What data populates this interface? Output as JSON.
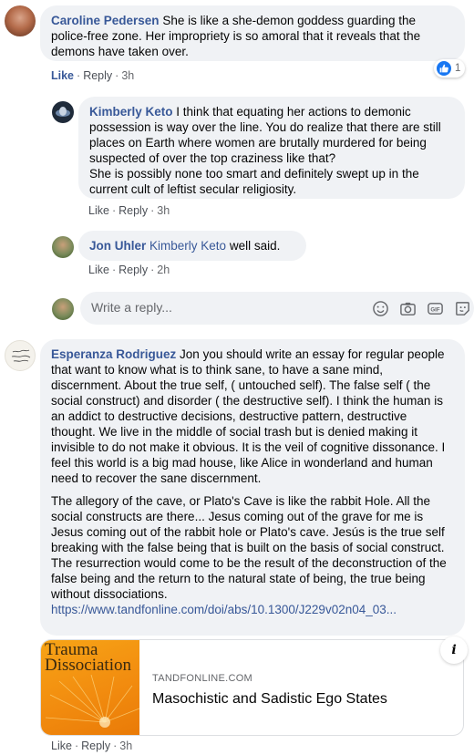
{
  "comments": [
    {
      "author": "Caroline Pedersen",
      "text": "She is like a she-demon goddess guarding the police-free zone. Her impropriety is so amoral that it reveals that the demons have taken over.",
      "like_label": "Like",
      "reply_label": "Reply",
      "time": "3h",
      "reaction_count": "1",
      "replies": [
        {
          "author": "Kimberly Keto",
          "text": "I think that equating her actions to demonic possession is way over the line. You do realize that there are still places on Earth where women are brutally murdered for being suspected of over the top craziness like that?",
          "text2": "She is possibly none too smart and definitely swept up in the current cult of leftist secular religiosity.",
          "like_label": "Like",
          "reply_label": "Reply",
          "time": "3h"
        },
        {
          "author": "Jon Uhler",
          "tag": "Kimberly Keto",
          "text": "well said.",
          "like_label": "Like",
          "reply_label": "Reply",
          "time": "2h"
        }
      ]
    },
    {
      "author": "Esperanza Rodriguez",
      "text": "Jon you should write an essay for regular people that want to know what is to think sane, to have a sane mind, discernment. About the true self, ( untouched self). The false self ( the social construct) and disorder ( the destructive self). I think the human is an addict to destructive decisions, destructive pattern, destructive thought. We live in the middle of social trash but is denied making it invisible to do not make it obvious. It is the veil of cognitive dissonance. I feel this world is a big mad house, like Alice in wonderland and human need to recover the sane discernment.",
      "text2": "The allegory of the cave, or Plato's Cave is like the rabbit Hole. All the social constructs are there... Jesus coming out of the grave for me is Jesus coming out of the rabbit hole or Plato's cave. Jesús is the true self breaking with the false being that is built on the basis of social construct. The resurrection would come to be the result of the deconstruction of the false being and the return to the natural state of being, the true being without dissociations.",
      "url": "https://www.tandfonline.com/doi/abs/10.1300/J229v02n04_03...",
      "like_label": "Like",
      "reply_label": "Reply",
      "time": "3h",
      "link_card": {
        "cover_title": "Trauma\nDissociation",
        "domain": "TANDFONLINE.COM",
        "title": "Masochistic and Sadistic Ego States",
        "info_label": "i"
      }
    }
  ],
  "reply_box": {
    "placeholder": "Write a reply..."
  },
  "icons": [
    "smiley-icon",
    "camera-icon",
    "gif-icon",
    "sticker-icon",
    "thumbs-up-icon",
    "info-icon"
  ],
  "colors": {
    "author": "#385898",
    "bubble": "#f0f2f5",
    "meta": "#65676b",
    "like_blue": "#1877f2"
  }
}
